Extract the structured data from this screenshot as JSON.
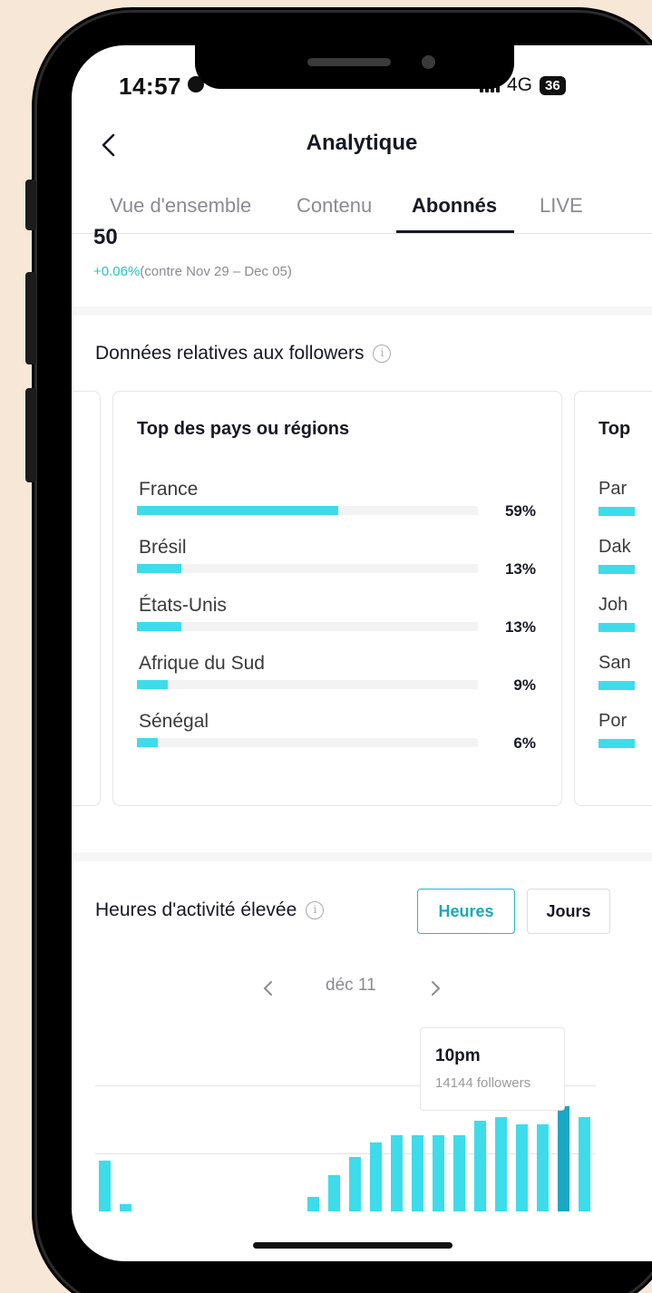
{
  "status_bar": {
    "time": "14:57",
    "network": "4G",
    "battery": "36"
  },
  "header": {
    "title": "Analytique"
  },
  "tabs": [
    {
      "label": "Vue d'ensemble"
    },
    {
      "label": "Contenu"
    },
    {
      "label": "Abonnés"
    },
    {
      "label": "LIVE"
    }
  ],
  "summary": {
    "partial_value": "50",
    "change_value": "+0.06%",
    "change_context": "(contre Nov 29 – Dec 05)"
  },
  "followers_section": {
    "title": "Données relatives aux followers",
    "countries_card": {
      "title": "Top des pays ou régions",
      "items": [
        {
          "name": "France",
          "percent": "59%",
          "value": 0.59
        },
        {
          "name": "Brésil",
          "percent": "13%",
          "value": 0.13
        },
        {
          "name": "États-Unis",
          "percent": "13%",
          "value": 0.13
        },
        {
          "name": "Afrique du Sud",
          "percent": "9%",
          "value": 0.09
        },
        {
          "name": "Sénégal",
          "percent": "6%",
          "value": 0.06
        }
      ]
    },
    "cities_card": {
      "title_partial": "Top",
      "items_partial": [
        "Par",
        "Dak",
        "Joh",
        "San",
        "Por"
      ]
    }
  },
  "activity_section": {
    "title": "Heures d'activité élevée",
    "toggle": {
      "hours": "Heures",
      "days": "Jours"
    },
    "date_label": "déc 11",
    "tooltip": {
      "time": "10pm",
      "value": "14144 followers"
    }
  },
  "colors": {
    "accent": "#3ddceb",
    "accent_selected": "#1ba6c4",
    "text": "#161823",
    "muted": "#8a8b91"
  },
  "chart_data": {
    "type": "bar",
    "values": [
      14,
      2,
      0,
      0,
      0,
      0,
      0,
      0,
      0,
      0,
      4,
      10,
      15,
      19,
      21,
      21,
      21,
      21,
      25,
      26,
      24,
      24,
      29,
      26
    ],
    "selected_index": 22
  }
}
